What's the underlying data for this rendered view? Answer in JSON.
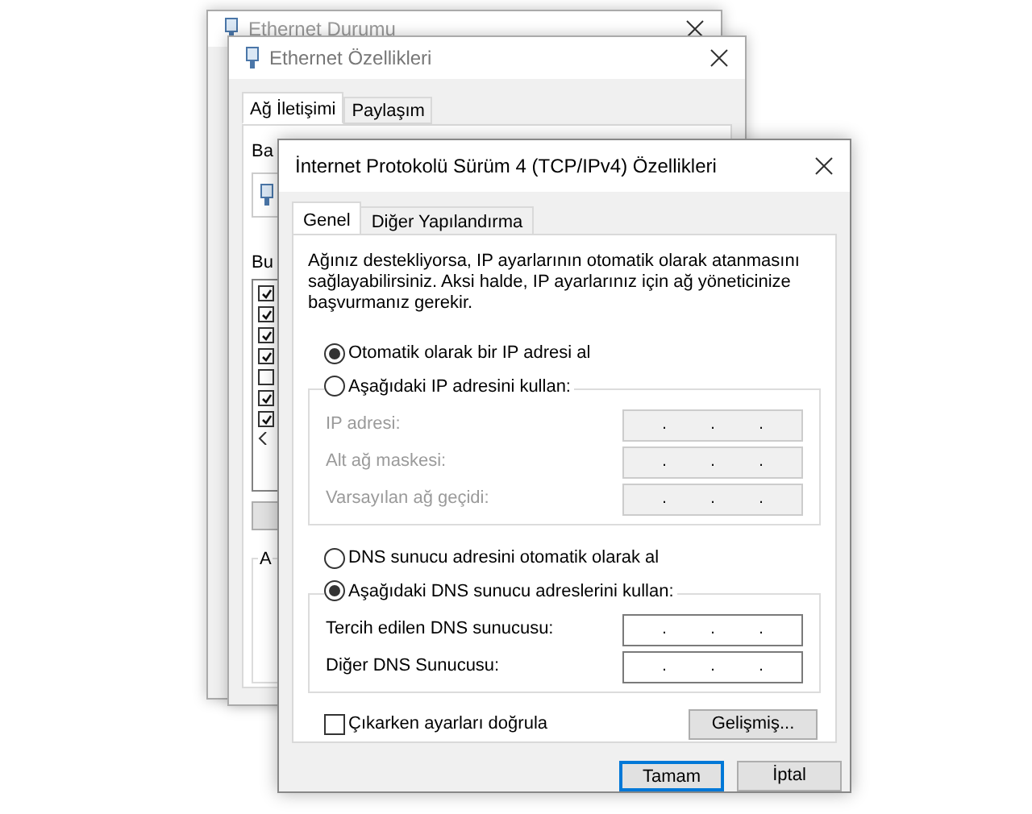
{
  "back_window": {
    "title": "Ethernet Durumu"
  },
  "middle_window": {
    "title": "Ethernet Özellikleri",
    "tabs": [
      {
        "label": "Ağ İletişimi",
        "selected": true
      },
      {
        "label": "Paylaşım",
        "selected": false
      }
    ],
    "connection_label": "Ba",
    "components_label": "Bu",
    "group_label": "A",
    "components": [
      {
        "checked": true
      },
      {
        "checked": true
      },
      {
        "checked": true
      },
      {
        "checked": true
      },
      {
        "checked": false
      },
      {
        "checked": true
      },
      {
        "checked": true
      }
    ]
  },
  "dialog": {
    "title": "İnternet Protokolü Sürüm 4 (TCP/IPv4) Özellikleri",
    "tabs": [
      {
        "label": "Genel",
        "selected": true
      },
      {
        "label": "Diğer Yapılandırma",
        "selected": false
      }
    ],
    "description": "Ağınız destekliyorsa, IP ayarlarının otomatik olarak atanmasını sağlayabilirsiniz. Aksi halde, IP ayarlarınız için ağ yöneticinize başvurmanız gerekir.",
    "ip_options": [
      {
        "label": "Otomatik olarak bir IP adresi al",
        "selected": true
      },
      {
        "label": "Aşağıdaki IP adresini kullan:",
        "selected": false
      }
    ],
    "ip_fields": [
      {
        "label": "IP adresi:",
        "separators": [
          ".",
          ".",
          "."
        ],
        "disabled": true
      },
      {
        "label": "Alt ağ maskesi:",
        "separators": [
          ".",
          ".",
          "."
        ],
        "disabled": true
      },
      {
        "label": "Varsayılan ağ geçidi:",
        "separators": [
          ".",
          ".",
          "."
        ],
        "disabled": true
      }
    ],
    "dns_options": [
      {
        "label": "DNS sunucu adresini otomatik olarak al",
        "selected": false
      },
      {
        "label": "Aşağıdaki DNS sunucu adreslerini kullan:",
        "selected": true
      }
    ],
    "dns_fields": [
      {
        "label": "Tercih edilen DNS sunucusu:",
        "separators": [
          ".",
          ".",
          "."
        ],
        "disabled": false
      },
      {
        "label": "Diğer DNS Sunucusu:",
        "separators": [
          ".",
          ".",
          "."
        ],
        "disabled": false
      }
    ],
    "validate": {
      "label": "Çıkarken ayarları doğrula",
      "checked": false
    },
    "advanced_button": "Gelişmiş...",
    "buttons": [
      {
        "label": "Tamam",
        "default": true
      },
      {
        "label": "İptal",
        "default": false
      }
    ]
  }
}
